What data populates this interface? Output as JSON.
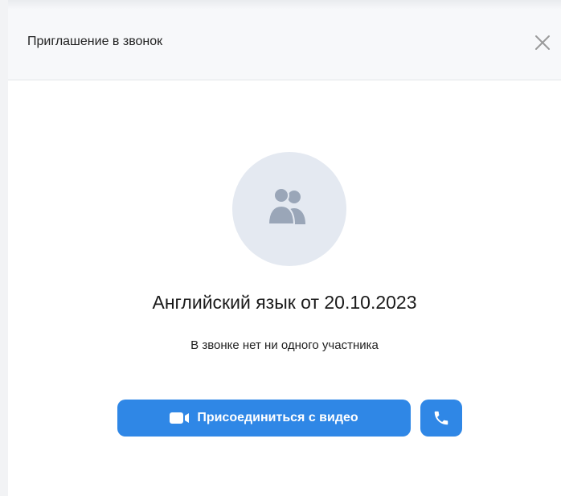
{
  "dialog": {
    "title": "Приглашение в звонок",
    "close_icon": "close-icon"
  },
  "call": {
    "avatar_icon": "group-users-icon",
    "title": "Английский язык от 20.10.2023",
    "status": "В звонке нет ни одного участника"
  },
  "actions": {
    "join_video_label": "Присоединиться с видео",
    "join_video_icon": "video-camera-icon",
    "audio_call_icon": "phone-icon"
  },
  "colors": {
    "accent": "#2f87e6",
    "avatar_bg": "#e4e9f1",
    "avatar_icon": "#9aa6b8",
    "header_bg": "#f7f8fa"
  }
}
